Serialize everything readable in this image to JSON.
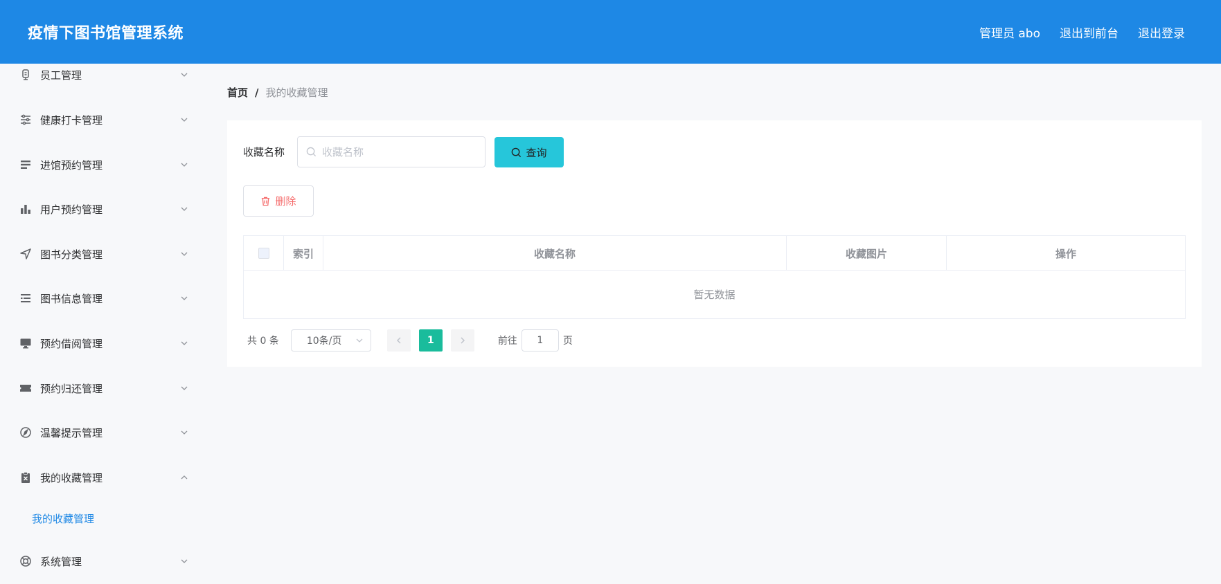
{
  "header": {
    "title": "疫情下图书馆管理系统",
    "user": "管理员 abo",
    "front_link": "退出到前台",
    "logout": "退出登录"
  },
  "sidebar": {
    "items": [
      {
        "label": "员工管理",
        "icon": "employee-icon",
        "expanded": false
      },
      {
        "label": "健康打卡管理",
        "icon": "sliders-icon",
        "expanded": false
      },
      {
        "label": "进馆预约管理",
        "icon": "list-icon",
        "expanded": false
      },
      {
        "label": "用户预约管理",
        "icon": "bar-chart-icon",
        "expanded": false
      },
      {
        "label": "图书分类管理",
        "icon": "navigation-icon",
        "expanded": false
      },
      {
        "label": "图书信息管理",
        "icon": "list-indent-icon",
        "expanded": false
      },
      {
        "label": "预约借阅管理",
        "icon": "monitor-icon",
        "expanded": false
      },
      {
        "label": "预约归还管理",
        "icon": "ticket-icon",
        "expanded": false
      },
      {
        "label": "温馨提示管理",
        "icon": "compass-icon",
        "expanded": false
      },
      {
        "label": "我的收藏管理",
        "icon": "clipboard-x-icon",
        "expanded": true
      },
      {
        "label": "系统管理",
        "icon": "lifebuoy-icon",
        "expanded": false
      }
    ],
    "subitem": "我的收藏管理"
  },
  "breadcrumb": {
    "home": "首页",
    "separator": "/",
    "current": "我的收藏管理"
  },
  "search": {
    "label": "收藏名称",
    "placeholder": "收藏名称",
    "value": "",
    "query_button": "查询"
  },
  "actions": {
    "delete_button": "删除"
  },
  "table": {
    "columns": [
      "索引",
      "收藏名称",
      "收藏图片",
      "操作"
    ],
    "rows": [],
    "empty_text": "暂无数据"
  },
  "pagination": {
    "total": "共 0 条",
    "page_size": "10条/页",
    "current_page": "1",
    "goto_label": "前往",
    "goto_value": "1",
    "page_suffix": "页"
  },
  "colors": {
    "header_bg": "#1e88e5",
    "query_btn": "#26c6da",
    "active_page": "#1abc9c",
    "delete_text": "#f56c6c",
    "active_submenu": "#1e88e5"
  }
}
